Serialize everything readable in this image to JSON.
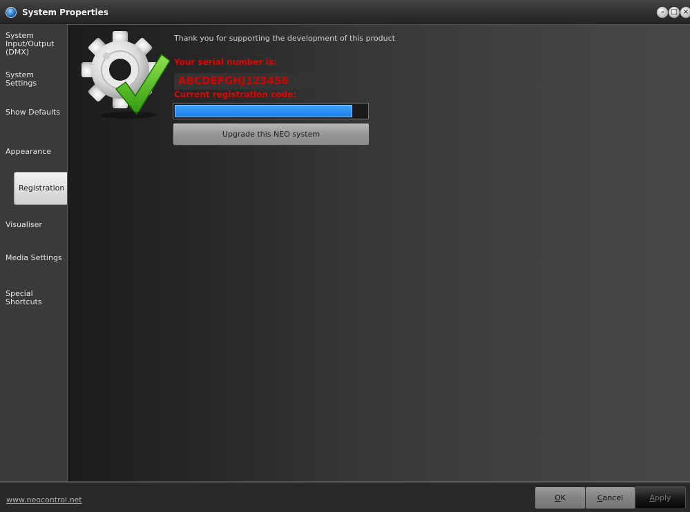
{
  "window": {
    "title": "System Properties",
    "controls": [
      "minimize-icon",
      "maximize-icon",
      "close-icon"
    ]
  },
  "sidebar": {
    "items": [
      {
        "label": "System Input/Output (DMX)",
        "active": false
      },
      {
        "label": "System Settings",
        "active": false
      },
      {
        "label": "Show Defaults",
        "active": false
      },
      {
        "label": "Appearance",
        "active": false
      },
      {
        "label": "Registration",
        "active": true
      },
      {
        "label": "Visualiser",
        "active": false
      },
      {
        "label": "Media Settings",
        "active": false
      },
      {
        "label": "Special Shortcuts",
        "active": false
      }
    ]
  },
  "registration": {
    "thanks": "Thank you for supporting the development of this product",
    "serial_label": "Your serial number is:",
    "serial_value": "ABCDEFGHJ123456",
    "code_label": "Current registration code:",
    "code_progress": 0.925,
    "upgrade_label": "Upgrade this NEO system",
    "graphic": "gear-checkmark-icon"
  },
  "footer": {
    "link": "www.neocontrol.net",
    "ok_key": "O",
    "ok_rest": "K",
    "cancel_key": "C",
    "cancel_rest": "ancel",
    "apply_key": "A",
    "apply_rest": "pply"
  },
  "colors": {
    "accent_blue": "#1a80e8",
    "label_red": "#e00000"
  }
}
